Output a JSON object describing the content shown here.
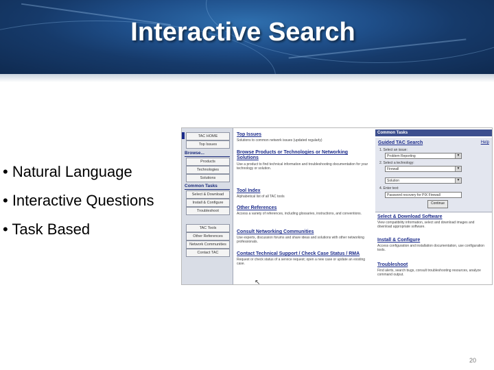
{
  "slide": {
    "title": "Interactive Search",
    "bullets": [
      "• Natural Language",
      "• Interactive Questions",
      "• Task Based"
    ],
    "page_number": "20"
  },
  "screenshot": {
    "left_nav": {
      "top_buttons": [
        "TAC HOME",
        "Top Issues"
      ],
      "browse_heading": "Browse...",
      "browse_buttons": [
        "Products",
        "Technologies",
        "Solutions"
      ],
      "tasks_heading": "Common Tasks",
      "task_buttons": [
        "Select & Download",
        "Install & Configure",
        "Troubleshoot"
      ],
      "other_buttons": [
        "TAC Tools",
        "Other References",
        "Network Communities",
        "Contact TAC"
      ]
    },
    "center": {
      "sections": [
        {
          "title": "Top Issues",
          "text": "Solutions to common network issues (updated regularly)"
        },
        {
          "title": "Browse Products or Technologies or Networking Solutions",
          "text": "Use a product to find technical information and troubleshooting documentation for your technology or solution."
        },
        {
          "title": "Tool Index",
          "text": "Alphabetical list of all TAC tools"
        },
        {
          "title": "Other References",
          "text": "Access a variety of references, including glossaries, instructions, and conventions."
        },
        {
          "title": "Consult Networking Communities",
          "text": "Use experts, discussion forums and share ideas and solutions with other networking professionals."
        },
        {
          "title": "Contact Technical Support / Check Case Status / RMA",
          "text": "Request or check status of a service request; open a new case or update an existing case."
        }
      ]
    },
    "right": {
      "common_tasks_label": "Common Tasks",
      "tac_search": {
        "title": "Guided TAC Search",
        "help": "Help",
        "step1_label": "1. Select an issue:",
        "step1_value": "Problem Reporting",
        "step2_label": "2. Select a technology:",
        "step2_value": "Firewall",
        "step3_value": "Solution",
        "step4_label": "4. Enter text:",
        "text_value": "Password recovery for PIX Firewall",
        "button": "Continue"
      },
      "sections": [
        {
          "title": "Select & Download Software",
          "text": "View compatibility information, select and download images and download appropriate software."
        },
        {
          "title": "Install & Configure",
          "text": "Access configuration and installation documentation, use configuration tools."
        },
        {
          "title": "Troubleshoot",
          "text": "Find alerts, search bugs, consult troubleshooting resources, analyze command output."
        }
      ]
    }
  }
}
